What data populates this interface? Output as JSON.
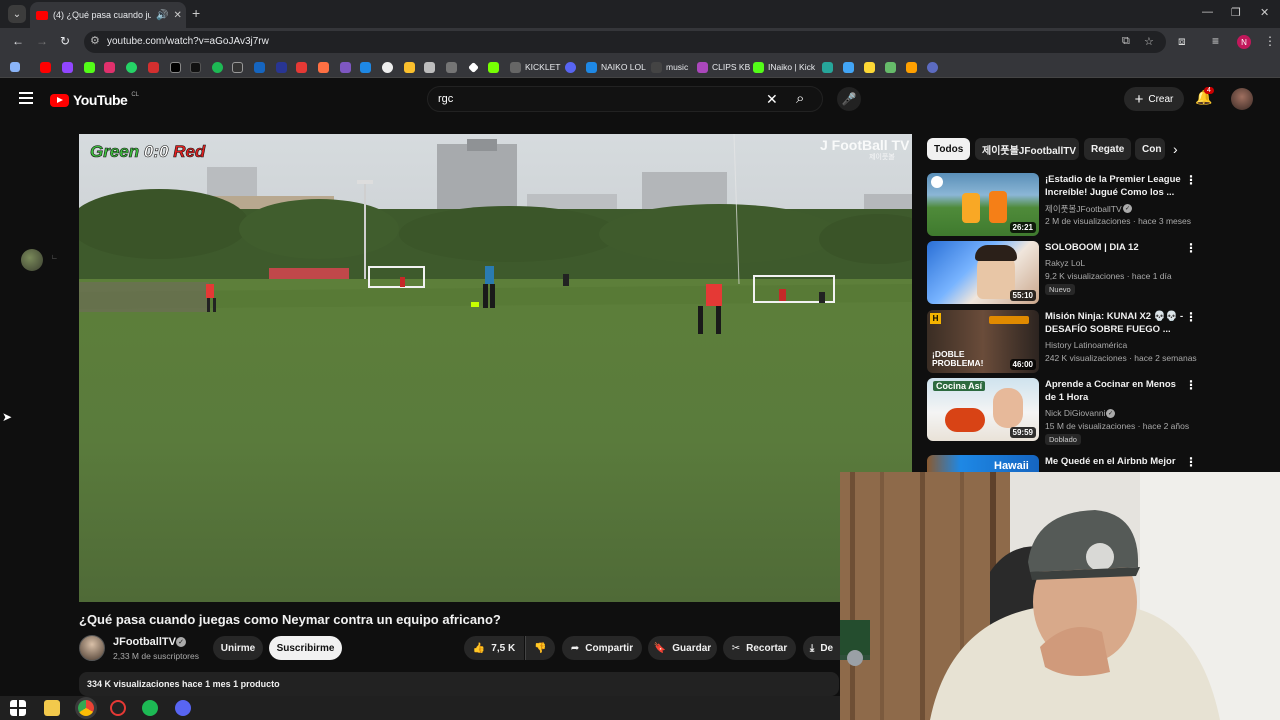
{
  "browser": {
    "tab_title": "(4) ¿Qué pasa cuando juega",
    "url": "youtube.com/watch?v=aGoJAv3j7rw",
    "profile_initial": "N",
    "bookmarks": [
      "KICKLET",
      "NAIKO LOL",
      "music",
      "CLIPS KB",
      "INaiko | Kick"
    ]
  },
  "youtube": {
    "logo_text": "YouTube",
    "country_code": "CL",
    "search_query": "rgc",
    "create_label": "Crear",
    "notification_count": "4"
  },
  "video": {
    "score_green": "Green",
    "score_value": "0:0",
    "score_red": "Red",
    "watermark": "J FootBall TV",
    "watermark_sub": "제이풋볼",
    "title": "¿Qué pasa cuando juegas como Neymar contra un equipo africano?",
    "channel_name": "JFootballTV",
    "subscribers": "2,33 M de suscriptores",
    "join_label": "Unirme",
    "subscribe_label": "Suscribirme",
    "likes": "7,5 K",
    "share_label": "Compartir",
    "save_label": "Guardar",
    "clip_label": "Recortar",
    "download_label": "De",
    "stats": "334 K visualizaciones  hace 1 mes  1 producto"
  },
  "chips": [
    "Todos",
    "제이풋볼JFootballTV",
    "Regate",
    "Con"
  ],
  "recommendations": [
    {
      "title": "¡Estadio de la Premier League Increíble! Jugué Como los ...",
      "channel": "제이풋볼JFootballTV",
      "meta": "2 M de visualizaciones · hace 3 meses",
      "duration": "26:21",
      "tag": ""
    },
    {
      "title": "SOLOBOOM | DIA 12",
      "channel": "Rakyz LoL",
      "meta": "9,2 K visualizaciones · hace 1 día",
      "duration": "55:10",
      "tag": "Nuevo"
    },
    {
      "title": "Misión Ninja: KUNAI X2 💀💀 - DESAFÍO SOBRE FUEGO ...",
      "channel": "History Latinoamérica",
      "meta": "242 K visualizaciones · hace 2 semanas",
      "duration": "46:00",
      "tag": "",
      "thumb_text": "¡DOBLE PROBLEMA!"
    },
    {
      "title": "Aprende a Cocinar en Menos de 1 Hora",
      "channel": "Nick DiGiovanni",
      "meta": "15 M de visualizaciones · hace 2 años",
      "duration": "59:59",
      "tag": "Doblado",
      "thumb_text": "Cocina Así"
    },
    {
      "title": "Me Quedé en el Airbnb Mejor",
      "channel": "",
      "meta": "",
      "duration": "",
      "tag": "",
      "thumb_text": "Hawaii"
    }
  ],
  "colors": {
    "background": "#0f0f0f",
    "youtube_red": "#ff0000",
    "pill": "#272727",
    "score_green": "#3fbf3f",
    "score_red": "#e02020"
  }
}
